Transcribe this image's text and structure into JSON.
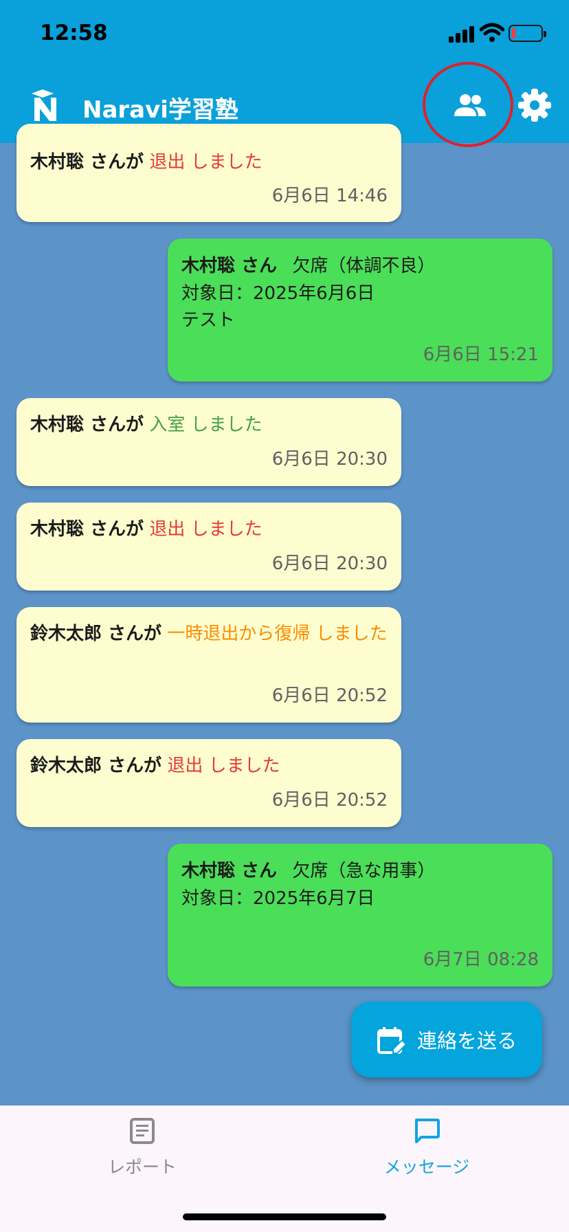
{
  "status_bar": {
    "time": "12:58"
  },
  "header": {
    "title": "Naravi学習塾",
    "logo_letter": "N",
    "students_icon": "people-icon",
    "settings_icon": "gear-icon"
  },
  "colors": {
    "header": "#0aa0da",
    "background": "#5c93c8",
    "yellow_bubble": "#fefdd0",
    "green_bubble": "#4bde59",
    "red_action": "#e53935",
    "green_action": "#43a047",
    "orange_action": "#fb8c00",
    "fab": "#04a4dc",
    "nav_active": "#14a4df",
    "nav_inactive": "#8a8a8a",
    "highlight_ring": "#e0202a"
  },
  "messages": [
    {
      "type": "event",
      "name": "木村聡 さんが",
      "action": "退出 しました",
      "time": "6月6日 14:46"
    },
    {
      "type": "absence",
      "name": "木村聡 さん",
      "reason": "欠席（体調不良）",
      "date_line": "対象日：2025年6月6日",
      "note": "テスト",
      "time": "6月6日 15:21"
    },
    {
      "type": "event",
      "name": "木村聡 さんが",
      "action": "入室 しました",
      "time": "6月6日 20:30"
    },
    {
      "type": "event",
      "name": "木村聡 さんが",
      "action": "退出 しました",
      "time": "6月6日 20:30"
    },
    {
      "type": "event",
      "name": "鈴木太郎 さんが",
      "action": "一時退出から復帰 しました",
      "time": "6月6日 20:52"
    },
    {
      "type": "event",
      "name": "鈴木太郎 さんが",
      "action": "退出 しました",
      "time": "6月6日 20:52"
    },
    {
      "type": "absence",
      "name": "木村聡 さん",
      "reason": "欠席（急な用事）",
      "date_line": "対象日：2025年6月7日",
      "note": "",
      "time": "6月7日 08:28"
    }
  ],
  "fab": {
    "label": "連絡を送る",
    "icon": "calendar-edit-icon"
  },
  "bottom_nav": {
    "items": [
      {
        "label": "レポート",
        "icon": "report-icon",
        "active": false
      },
      {
        "label": "メッセージ",
        "icon": "chat-icon",
        "active": true
      }
    ]
  }
}
